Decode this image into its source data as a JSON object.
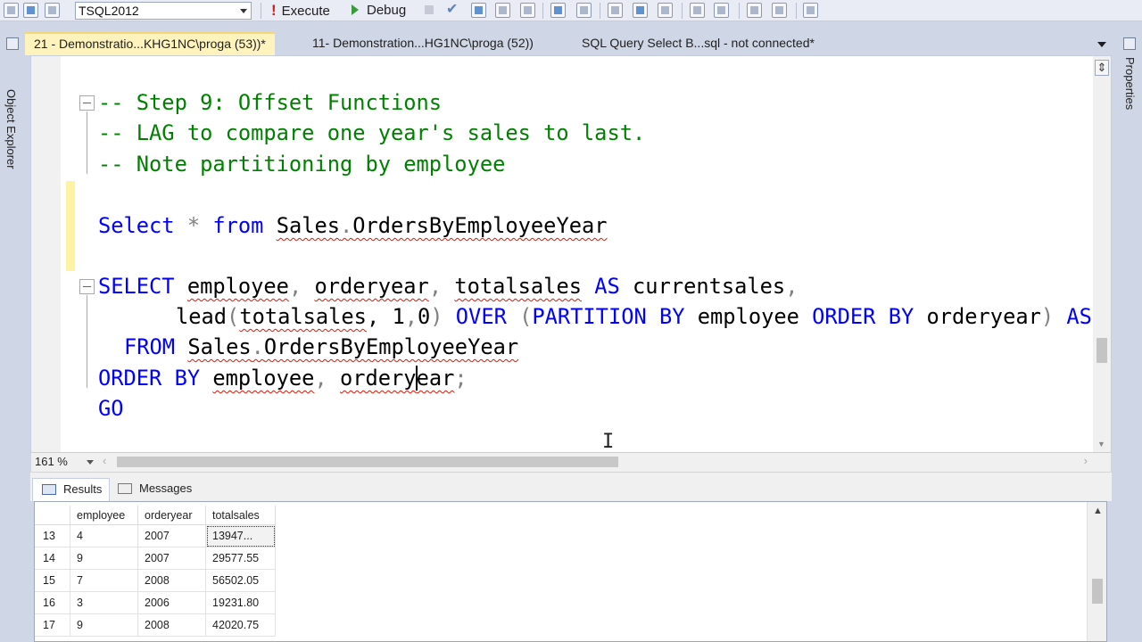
{
  "toolbar": {
    "database": "TSQL2012",
    "execute_label": "Execute",
    "debug_label": "Debug",
    "execute_glyph": "!",
    "check_glyph": "✔"
  },
  "side_panels": {
    "left_label": "Object Explorer",
    "right_label": "Properties"
  },
  "tabs": [
    {
      "label": "21 - Demonstratio...KHG1NC\\proga (53))*",
      "active": true
    },
    {
      "label": "11- Demonstration...HG1NC\\proga (52))",
      "active": false
    },
    {
      "label": "SQL Query Select B...sql - not connected*",
      "active": false
    }
  ],
  "editor": {
    "split_glyph": "⇕",
    "cursor_glyph": "I",
    "lines": {
      "l1": "-- Step 9: Offset Functions",
      "l2": "-- LAG to compare one year's sales to last.",
      "l3": "-- Note partitioning by employee",
      "l5": {
        "select": "Select",
        "star": "*",
        "from": "from",
        "sales": "Sales",
        "dot": ".",
        "obj": "OrdersByEmployeeYear"
      },
      "l7": {
        "select": "SELECT",
        "c1": "employee",
        "comma1": ",",
        "c2": "orderyear",
        "comma2": ",",
        "c3": "totalsales",
        "as": "AS",
        "alias": "currentsales",
        "comma3": ","
      },
      "l8": {
        "fn": "lead",
        "open": "(",
        "arg": "totalsales",
        "rest1": ", 1",
        "comma": ",",
        "zero": "0",
        "close": ")",
        "over": "OVER",
        "open2": "(",
        "partition": "PARTITION BY",
        "emp": "employee",
        "order": "ORDER BY",
        "oy": "orderyear",
        "close2": ")",
        "as": "AS"
      },
      "l9": {
        "from": "FROM",
        "sales": "Sales",
        "dot": ".",
        "obj": "OrdersByEmployeeYear"
      },
      "l10": {
        "order": "ORDER BY",
        "c1": "employee",
        "comma": ",",
        "c2a": "ordery",
        "c2b": "ear",
        "semi": ";"
      },
      "l11": "GO"
    }
  },
  "statusbar": {
    "zoom": "161 %",
    "left_arrow": "‹",
    "right_arrow": "›"
  },
  "results": {
    "tabs": {
      "results_label": "Results",
      "messages_label": "Messages"
    },
    "columns": [
      "employee",
      "orderyear",
      "totalsales"
    ],
    "rows": [
      {
        "num": "13",
        "employee": "4",
        "orderyear": "2007",
        "totalsales": "13947..."
      },
      {
        "num": "14",
        "employee": "9",
        "orderyear": "2007",
        "totalsales": "29577.55"
      },
      {
        "num": "15",
        "employee": "7",
        "orderyear": "2008",
        "totalsales": "56502.05"
      },
      {
        "num": "16",
        "employee": "3",
        "orderyear": "2006",
        "totalsales": "19231.80"
      },
      {
        "num": "17",
        "employee": "9",
        "orderyear": "2008",
        "totalsales": "42020.75"
      }
    ]
  }
}
